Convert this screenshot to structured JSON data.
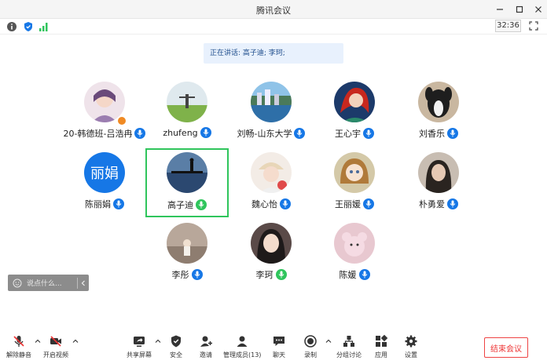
{
  "window": {
    "title": "腾讯会议"
  },
  "infobar": {
    "timer": "32:36"
  },
  "speaking": {
    "text": "正在讲话: 高子迪; 李珂;"
  },
  "participants": [
    {
      "name": "20-韩德班-吕浩冉",
      "mic": "blue"
    },
    {
      "name": "zhufeng",
      "mic": "blue"
    },
    {
      "name": "刘畅-山东大学",
      "mic": "blue"
    },
    {
      "name": "王心宇",
      "mic": "blue"
    },
    {
      "name": "刘香乐",
      "mic": "blue"
    },
    {
      "name": "陈丽娟",
      "mic": "blue",
      "avatar_text": "丽娟"
    },
    {
      "name": "高子迪",
      "mic": "green"
    },
    {
      "name": "魏心怡",
      "mic": "blue"
    },
    {
      "name": "王丽媛",
      "mic": "blue"
    },
    {
      "name": "朴勇爱",
      "mic": "blue"
    },
    {
      "name": "李彤",
      "mic": "blue"
    },
    {
      "name": "李珂",
      "mic": "green"
    },
    {
      "name": "陈媛",
      "mic": "blue"
    }
  ],
  "chat": {
    "placeholder": "说点什么..."
  },
  "toolbar": {
    "unmute": "解除静音",
    "start_video": "开启视频",
    "share_screen": "共享屏幕",
    "security": "安全",
    "invite": "邀请",
    "manage_members": "管理成员(13)",
    "chat": "聊天",
    "record": "录制",
    "breakout": "分组讨论",
    "apps": "应用",
    "settings": "设置",
    "end_meeting": "结束会议"
  },
  "colors": {
    "accent": "#1677e6",
    "speaking_green": "#2fc55c",
    "end_red": "#e33333"
  }
}
